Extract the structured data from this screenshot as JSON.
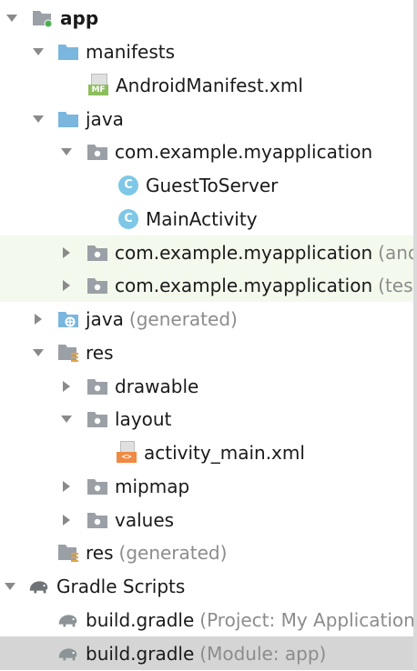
{
  "colors": {
    "folder_blue": "#7ab6dd",
    "folder_grey": "#9aa0a6",
    "class_badge": "#7ec7e6",
    "android_badge": "#4caf50",
    "test_row_highlight": "#f3f9ec",
    "selection": "#d5d5d5",
    "hint_text": "#8c8c8c"
  },
  "tree": [
    {
      "label": "app",
      "hint": "",
      "icon": "module-folder-icon",
      "expanded": true
    },
    {
      "label": "manifests",
      "hint": "",
      "icon": "folder-icon",
      "expanded": true
    },
    {
      "label": "AndroidManifest.xml",
      "hint": "",
      "icon": "manifest-file-icon",
      "badge": "MF"
    },
    {
      "label": "java",
      "hint": "",
      "icon": "folder-icon",
      "expanded": true
    },
    {
      "label": "com.example.myapplication",
      "hint": "",
      "icon": "package-icon",
      "expanded": true
    },
    {
      "label": "GuestToServer",
      "hint": "",
      "icon": "class-icon",
      "badge": "C"
    },
    {
      "label": "MainActivity",
      "hint": "",
      "icon": "class-icon",
      "badge": "C"
    },
    {
      "label": "com.example.myapplication",
      "hint": "(androidTest)",
      "icon": "package-icon",
      "expanded": false
    },
    {
      "label": "com.example.myapplication",
      "hint": "(test)",
      "icon": "package-icon",
      "expanded": false
    },
    {
      "label": "java",
      "hint": "(generated)",
      "icon": "generated-folder-icon",
      "expanded": false
    },
    {
      "label": "res",
      "hint": "",
      "icon": "resources-folder-icon",
      "expanded": true
    },
    {
      "label": "drawable",
      "hint": "",
      "icon": "package-icon",
      "expanded": false
    },
    {
      "label": "layout",
      "hint": "",
      "icon": "package-icon",
      "expanded": true
    },
    {
      "label": "activity_main.xml",
      "hint": "",
      "icon": "layout-xml-icon",
      "badge": "<>"
    },
    {
      "label": "mipmap",
      "hint": "",
      "icon": "package-icon",
      "expanded": false
    },
    {
      "label": "values",
      "hint": "",
      "icon": "package-icon",
      "expanded": false
    },
    {
      "label": "res",
      "hint": "(generated)",
      "icon": "resources-folder-icon"
    },
    {
      "label": "Gradle Scripts",
      "hint": "",
      "icon": "gradle-elephant-icon",
      "expanded": true
    },
    {
      "label": "build.gradle",
      "hint": "(Project: My Application)",
      "icon": "gradle-file-icon"
    },
    {
      "label": "build.gradle",
      "hint": "(Module: app)",
      "icon": "gradle-file-icon"
    }
  ]
}
